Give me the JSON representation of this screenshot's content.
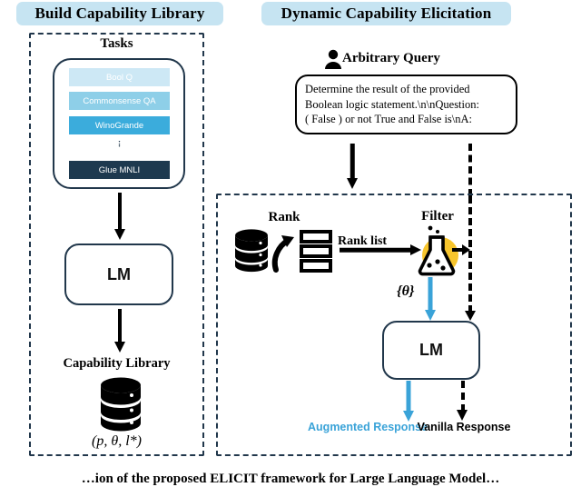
{
  "figure": {
    "caption": "…ion of the proposed ELICIT framework for Large Language Model…"
  },
  "left_panel": {
    "header": "Build Capability Library",
    "tasks_title": "Tasks",
    "tasks": [
      {
        "label": "Bool Q",
        "color": "#cde8f5"
      },
      {
        "label": "Commonsense QA",
        "color": "#8ecfe8"
      },
      {
        "label": "WinoGrande",
        "color": "#3bacdc"
      },
      {
        "label": "Glue MNLI",
        "color": "#1d394f"
      }
    ],
    "ellipsis": "⋮",
    "lm_label": "LM",
    "library_title": "Capability Library",
    "library_tuple": "(p, θ, l*)",
    "db_icon": "database-icon"
  },
  "right_panel": {
    "header": "Dynamic Capability Elicitation",
    "query_title": "Arbitrary Query",
    "query_icon": "person-icon",
    "query_lines": [
      "Determine the result of the provided",
      "Boolean logic statement.\\n\\nQuestion:",
      "( False ) or not True and False is\\nA:"
    ],
    "rank_title": "Rank",
    "rank_icons": [
      "database-icon",
      "curved-arrow-icon",
      "list-icon"
    ],
    "rank_list_label": "Rank list",
    "filter_title": "Filter",
    "filter_icon": "flask-icon",
    "theta_label": "{θ}",
    "lm_label": "LM",
    "augmented_response": "Augmented Response",
    "vanilla_response": "Vanilla Response"
  },
  "colors": {
    "header_bg": "#c6e4f2",
    "ink": "#21374b",
    "accent_blue": "#3aa3d8",
    "flask_yellow": "#f7c52d",
    "black": "#000000"
  }
}
